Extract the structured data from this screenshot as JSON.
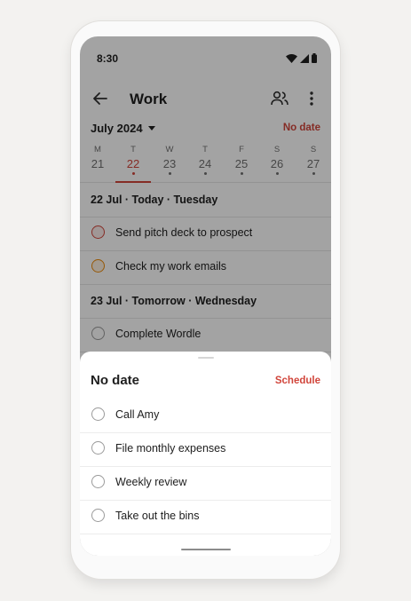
{
  "status": {
    "time": "8:30"
  },
  "header": {
    "title": "Work"
  },
  "calendar": {
    "month_label": "July 2024",
    "no_date_label": "No date",
    "days": [
      {
        "dow": "M",
        "num": "21",
        "selected": false
      },
      {
        "dow": "T",
        "num": "22",
        "selected": true
      },
      {
        "dow": "W",
        "num": "23",
        "selected": false
      },
      {
        "dow": "T",
        "num": "24",
        "selected": false
      },
      {
        "dow": "F",
        "num": "25",
        "selected": false
      },
      {
        "dow": "S",
        "num": "26",
        "selected": false
      },
      {
        "dow": "S",
        "num": "27",
        "selected": false
      }
    ]
  },
  "sections": [
    {
      "heading": "22 Jul · Today · Tuesday",
      "tasks": [
        {
          "label": "Send pitch deck to prospect",
          "priority": "p1"
        },
        {
          "label": "Check my work emails",
          "priority": "p2"
        }
      ]
    },
    {
      "heading": "23 Jul · Tomorrow · Wednesday",
      "tasks": [
        {
          "label": "Complete Wordle",
          "priority": "none"
        }
      ]
    }
  ],
  "sheet": {
    "title": "No date",
    "schedule_label": "Schedule",
    "tasks": [
      {
        "label": "Call Amy"
      },
      {
        "label": "File monthly expenses"
      },
      {
        "label": "Weekly review"
      },
      {
        "label": "Take out the bins"
      }
    ]
  },
  "colors": {
    "accent": "#d1453b",
    "p2": "#eb8909",
    "background": "#f3f2f0"
  }
}
